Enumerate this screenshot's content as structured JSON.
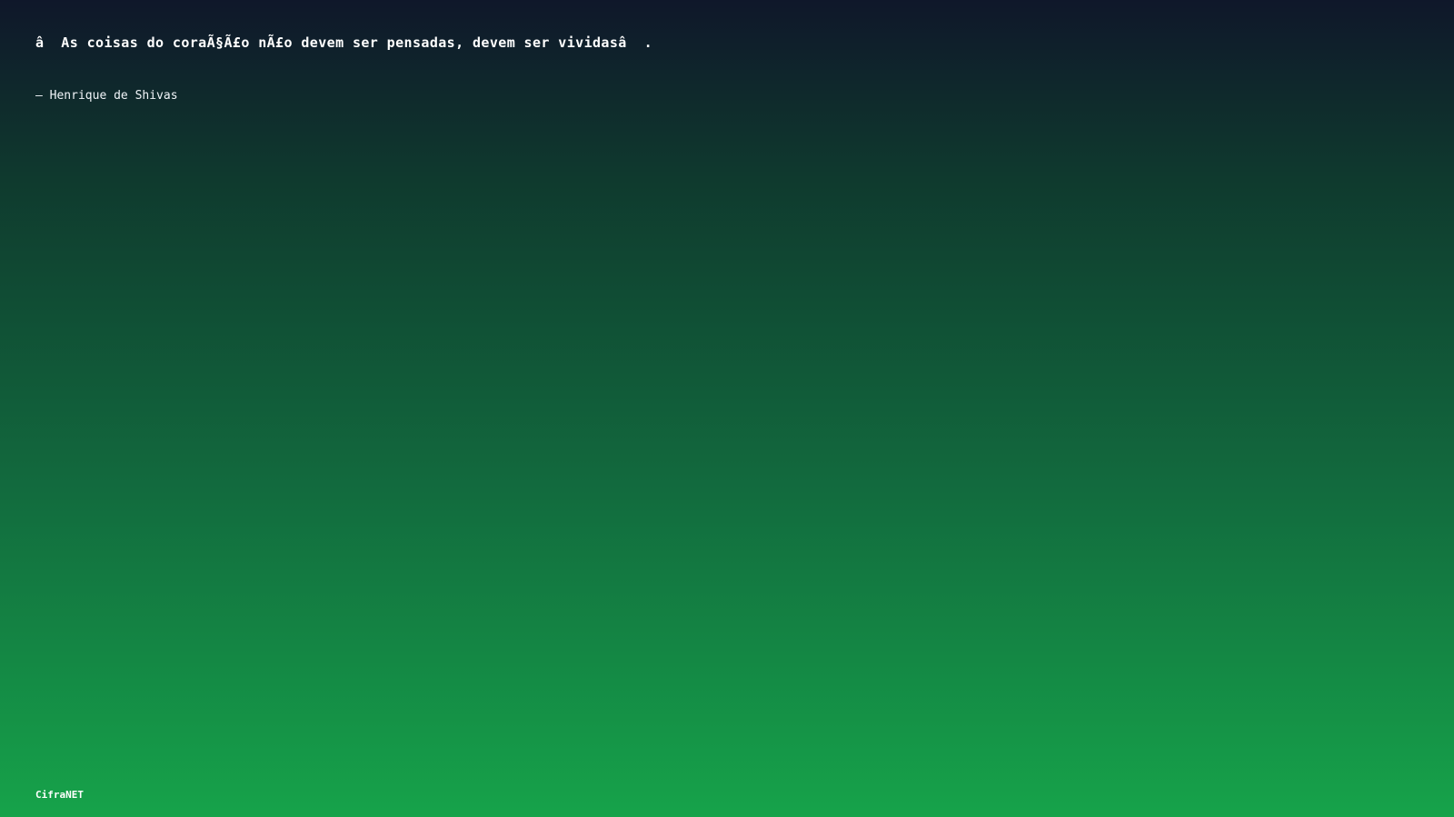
{
  "quote": {
    "text": "â  As coisas do coraÃ§Ã£o nÃ£o devem ser pensadas, devem ser vividasâ  ."
  },
  "author": {
    "text": "– Henrique de Shivas"
  },
  "brand": {
    "text": "CifraNET"
  },
  "colors": {
    "gradient_top": "#0f172a",
    "gradient_bottom": "#16a34a",
    "text": "#ffffff"
  }
}
